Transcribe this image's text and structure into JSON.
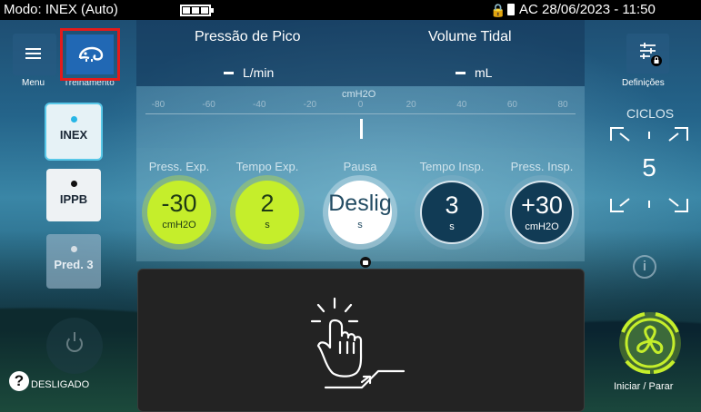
{
  "statusbar": {
    "mode": "Modo: INEX (Auto)",
    "power": "AC 28/06/2023 - 11:50",
    "battery_icon": "battery-icon",
    "lock_icon": "lock-icon"
  },
  "header": {
    "peak_pressure": {
      "label": "Pressão de Pico",
      "value": "",
      "unit": "L/min"
    },
    "tidal_volume": {
      "label": "Volume Tidal",
      "value": "",
      "unit": "mL"
    }
  },
  "left": {
    "menu_label": "Menu",
    "training_label": "Treinamento",
    "modes": [
      {
        "label": "INEX",
        "selected": true
      },
      {
        "label": "IPPB",
        "selected": false
      },
      {
        "label": "Pred. 3",
        "selected": false
      }
    ],
    "status": "DESLIGADO"
  },
  "scale": {
    "unit": "cmH2O",
    "ticks": [
      "-80",
      "-60",
      "-40",
      "-20",
      "0",
      "20",
      "40",
      "60",
      "80"
    ],
    "current_value": 0
  },
  "params": [
    {
      "label": "Press. Exp.",
      "value": "-30",
      "unit": "cmH2O",
      "style": "green"
    },
    {
      "label": "Tempo Exp.",
      "value": "2",
      "unit": "s",
      "style": "green"
    },
    {
      "label": "Pausa",
      "value": "Deslig",
      "unit": "s",
      "style": "white"
    },
    {
      "label": "Tempo Insp.",
      "value": "3",
      "unit": "s",
      "style": "navy"
    },
    {
      "label": "Press. Insp.",
      "value": "+30",
      "unit": "cmH2O",
      "style": "navy"
    }
  ],
  "right": {
    "settings_label": "Definições",
    "cycles_label": "CICLOS",
    "cycles_value": "5",
    "start_stop_label": "Iniciar / Parar"
  },
  "colors": {
    "accent_green": "#c5ee2b",
    "highlight_red": "#e41b1b",
    "navy": "#113b55"
  }
}
